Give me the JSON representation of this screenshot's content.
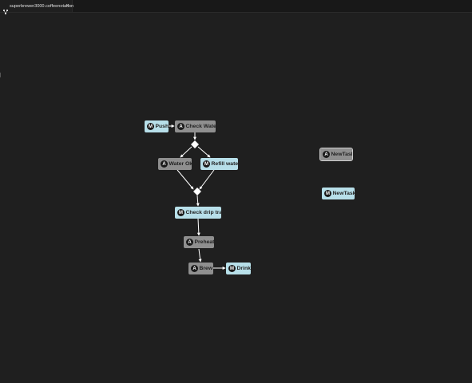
{
  "tab": {
    "title": "superbrewer3000.coffeenotation",
    "icon": "diagram-icon",
    "close_icon": "close-icon",
    "close_glyph": "×"
  },
  "colors": {
    "canvas_bg": "#1f1f1f",
    "manual_task": "#b7dfe9",
    "automatic_task": "#8f8f8f",
    "badge_bg": "#1a1a1a",
    "edge": "#ffffff"
  },
  "nodes": [
    {
      "id": "push",
      "kind": "manual",
      "badge": "M",
      "label": "Push"
    },
    {
      "id": "check-water",
      "kind": "auto",
      "badge": "A",
      "label": "Check Water"
    },
    {
      "id": "water-ok",
      "kind": "auto",
      "badge": "A",
      "label": "Water Ok"
    },
    {
      "id": "refill-water",
      "kind": "manual",
      "badge": "M",
      "label": "Refill water"
    },
    {
      "id": "check-drip-tray",
      "kind": "manual",
      "badge": "M",
      "label": "Check drip tray"
    },
    {
      "id": "preheat",
      "kind": "auto",
      "badge": "A",
      "label": "Preheat"
    },
    {
      "id": "brew",
      "kind": "auto",
      "badge": "A",
      "label": "Brew"
    },
    {
      "id": "drink",
      "kind": "manual",
      "badge": "M",
      "label": "Drink"
    },
    {
      "id": "newtask-auto",
      "kind": "auto",
      "badge": "A",
      "label": "NewTask"
    },
    {
      "id": "newtask-manual",
      "kind": "manual",
      "badge": "M",
      "label": "NewTask"
    }
  ]
}
